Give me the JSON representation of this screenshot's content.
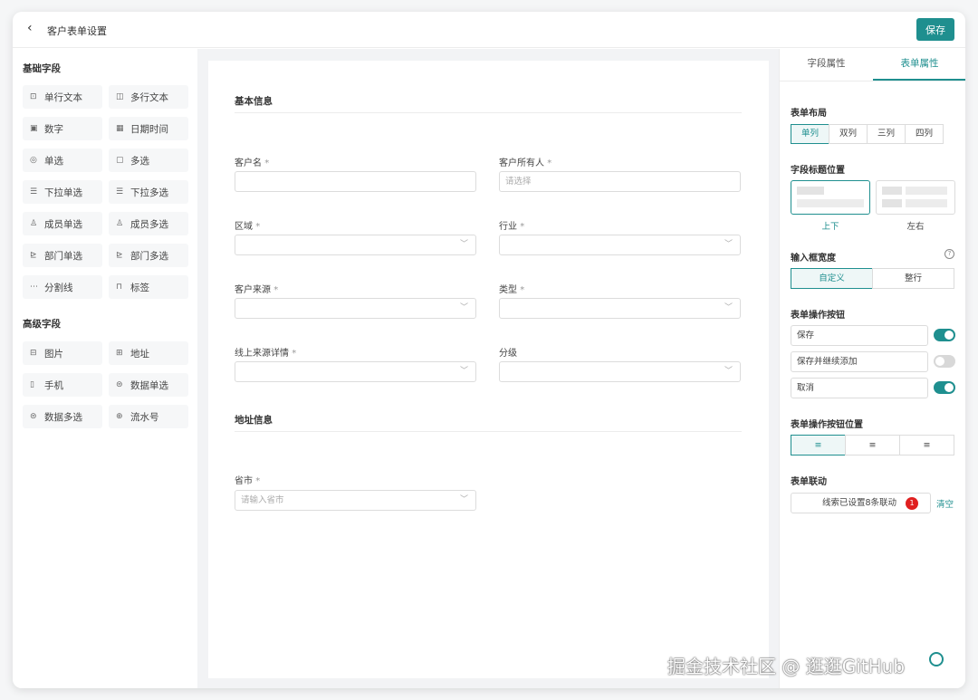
{
  "header": {
    "back_icon": "chevron-left-icon",
    "title": "客户表单设置",
    "save_label": "保存"
  },
  "left": {
    "basic_title": "基础字段",
    "basic_fields": [
      {
        "icon": "single-line-text-icon",
        "glyph": "⊡",
        "label": "单行文本"
      },
      {
        "icon": "multi-line-text-icon",
        "glyph": "◫",
        "label": "多行文本"
      },
      {
        "icon": "number-icon",
        "glyph": "▣",
        "label": "数字"
      },
      {
        "icon": "calendar-icon",
        "glyph": "▦",
        "label": "日期时间"
      },
      {
        "icon": "radio-icon",
        "glyph": "◎",
        "label": "单选"
      },
      {
        "icon": "checkbox-icon",
        "glyph": "▢",
        "label": "多选"
      },
      {
        "icon": "dropdown-list-icon",
        "glyph": "☰",
        "label": "下拉单选"
      },
      {
        "icon": "dropdown-multi-icon",
        "glyph": "☰",
        "label": "下拉多选"
      },
      {
        "icon": "member-icon",
        "glyph": "♙",
        "label": "成员单选"
      },
      {
        "icon": "members-icon",
        "glyph": "♙",
        "label": "成员多选"
      },
      {
        "icon": "department-icon",
        "glyph": "⊵",
        "label": "部门单选"
      },
      {
        "icon": "departments-icon",
        "glyph": "⊵",
        "label": "部门多选"
      },
      {
        "icon": "divider-icon",
        "glyph": "⋯",
        "label": "分割线"
      },
      {
        "icon": "tag-icon",
        "glyph": "⊓",
        "label": "标签"
      }
    ],
    "advanced_title": "高级字段",
    "advanced_fields": [
      {
        "icon": "image-icon",
        "glyph": "⊟",
        "label": "图片"
      },
      {
        "icon": "map-icon",
        "glyph": "⊞",
        "label": "地址"
      },
      {
        "icon": "phone-icon",
        "glyph": "▯",
        "label": "手机"
      },
      {
        "icon": "data-single-icon",
        "glyph": "⊜",
        "label": "数据单选"
      },
      {
        "icon": "data-multi-icon",
        "glyph": "⊜",
        "label": "数据多选"
      },
      {
        "icon": "serial-number-icon",
        "glyph": "⊕",
        "label": "流水号"
      }
    ]
  },
  "form": {
    "group1": "基本信息",
    "group2": "地址信息",
    "req": "*",
    "fields": [
      {
        "label": "客户名",
        "required": true,
        "placeholder": "",
        "dropdown": false
      },
      {
        "label": "客户所有人",
        "required": true,
        "placeholder": "请选择",
        "dropdown": false
      },
      {
        "label": "区域",
        "required": true,
        "placeholder": "",
        "dropdown": true
      },
      {
        "label": "行业",
        "required": true,
        "placeholder": "",
        "dropdown": true
      },
      {
        "label": "客户来源",
        "required": true,
        "placeholder": "",
        "dropdown": true
      },
      {
        "label": "类型",
        "required": true,
        "placeholder": "",
        "dropdown": true
      },
      {
        "label": "线上来源详情",
        "required": true,
        "placeholder": "",
        "dropdown": true
      },
      {
        "label": "分级",
        "required": false,
        "placeholder": "",
        "dropdown": true
      }
    ],
    "province": {
      "label": "省市",
      "placeholder": "请输入省市"
    }
  },
  "right": {
    "tab_field": "字段属性",
    "tab_form": "表单属性",
    "layout_label": "表单布局",
    "layout_options": [
      "单列",
      "双列",
      "三列",
      "四列"
    ],
    "title_pos_label": "字段标题位置",
    "title_pos_top": "上下",
    "title_pos_left": "左右",
    "width_label": "输入框宽度",
    "width_options": [
      "自定义",
      "整行"
    ],
    "actions_label": "表单操作按钮",
    "actions": [
      {
        "label": "保存",
        "on": true
      },
      {
        "label": "保存并继续添加",
        "on": false
      },
      {
        "label": "取消",
        "on": true
      }
    ],
    "actions_pos_label": "表单操作按钮位置",
    "linkage_label": "表单联动",
    "linkage_text": "线索已设置8条联动",
    "linkage_count": "1",
    "clear_label": "清空"
  },
  "watermark": "掘金技术社区 @ 逛逛GitHub",
  "colors": {
    "accent": "#1f8f8f",
    "badge": "#e02020"
  }
}
